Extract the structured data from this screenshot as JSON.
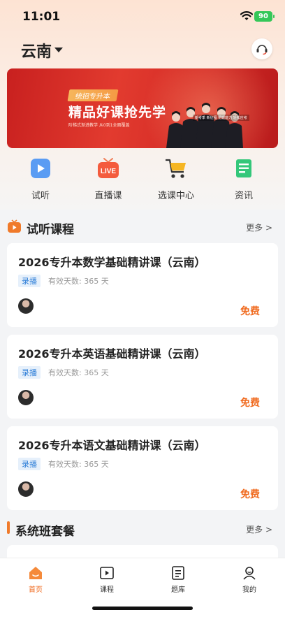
{
  "status_bar": {
    "time": "11:01",
    "battery": "90"
  },
  "header": {
    "city": "云南"
  },
  "banner": {
    "tag": "统招专升本",
    "headline": "精品好课抢先学",
    "sub": "阶梯式渐进教学 从0到1全面覆盖",
    "foot": "新考季 新征程 把握能力 轻松应考"
  },
  "quick_links": [
    {
      "label": "试听",
      "icon": "video-play-icon"
    },
    {
      "label": "直播课",
      "icon": "live-tv-icon"
    },
    {
      "label": "选课中心",
      "icon": "shopping-cart-icon"
    },
    {
      "label": "资讯",
      "icon": "document-icon"
    }
  ],
  "trial_section": {
    "title": "试听课程",
    "more": "更多 >"
  },
  "courses": [
    {
      "title": "2026专升本数学基础精讲课（云南）",
      "badge": "录播",
      "valid": "有效天数: 365 天",
      "price": "免费"
    },
    {
      "title": "2026专升本英语基础精讲课（云南）",
      "badge": "录播",
      "valid": "有效天数: 365 天",
      "price": "免费"
    },
    {
      "title": "2026专升本语文基础精讲课（云南）",
      "badge": "录播",
      "valid": "有效天数: 365 天",
      "price": "免费"
    }
  ],
  "package_section": {
    "title": "系统班套餐",
    "more": "更多 >"
  },
  "tabs": [
    {
      "label": "首页",
      "active": true
    },
    {
      "label": "课程",
      "active": false
    },
    {
      "label": "题库",
      "active": false
    },
    {
      "label": "我的",
      "active": false
    }
  ],
  "colors": {
    "accent": "#f06a1e",
    "badge_blue": "#2f7fd8",
    "banner_red": "#d42a25"
  }
}
